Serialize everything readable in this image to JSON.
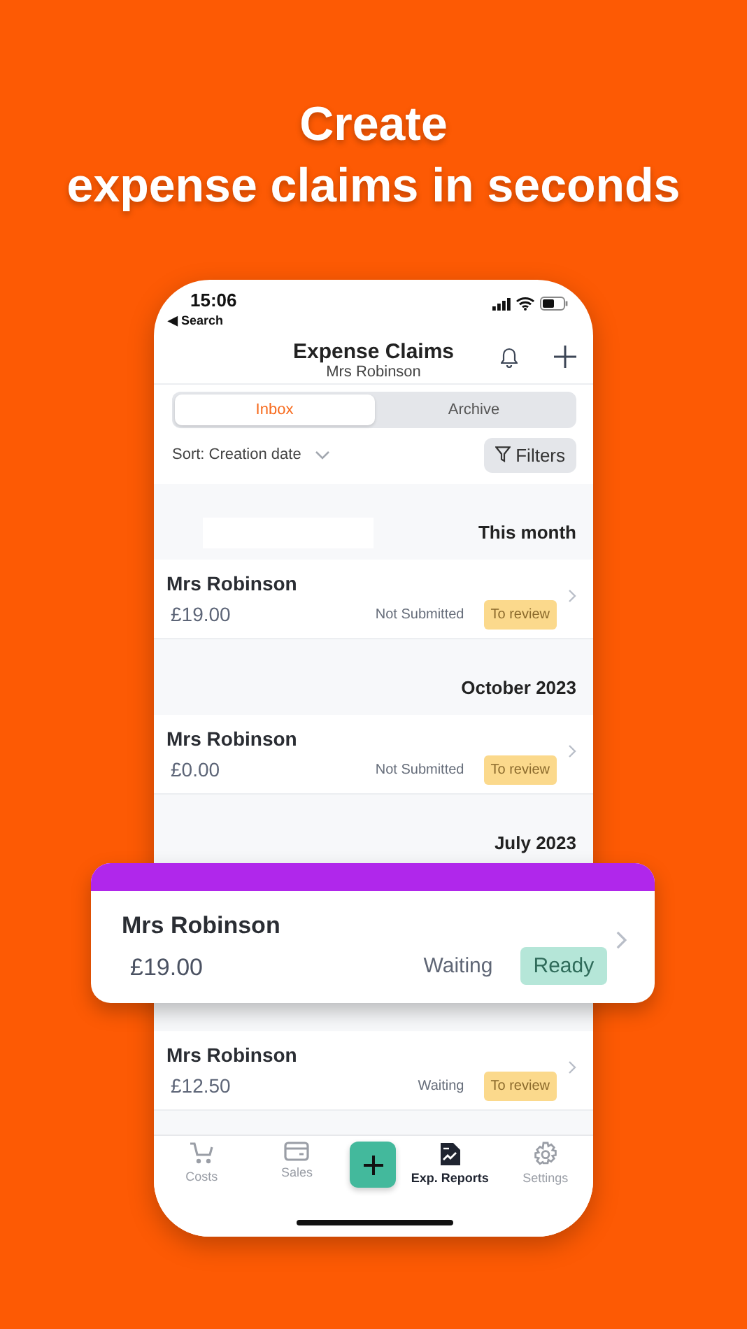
{
  "headline": [
    "Create",
    "expense claims in seconds"
  ],
  "status_bar": {
    "time": "15:06",
    "back_link": "◀ Search"
  },
  "header": {
    "title": "Expense Claims",
    "subtitle": "Mrs Robinson"
  },
  "tabs": [
    {
      "label": "Inbox",
      "selected": true
    },
    {
      "label": "Archive",
      "selected": false
    }
  ],
  "sort": "Sort: Creation date",
  "filters_button": "Filters",
  "list": [
    {
      "kind": "heading",
      "text": "This month"
    },
    {
      "kind": "claim",
      "name": "Mrs Robinson",
      "amount": "£19.00",
      "status": "Not Submitted",
      "badge": {
        "label": "To review",
        "kind": "review"
      }
    },
    {
      "kind": "heading",
      "text": "October 2023"
    },
    {
      "kind": "claim",
      "name": "Mrs Robinson",
      "amount": "£0.00",
      "status": "Not Submitted",
      "badge": {
        "label": "To review",
        "kind": "review"
      }
    },
    {
      "kind": "heading",
      "text": "July 2023"
    },
    {
      "kind": "heading"
    },
    {
      "kind": "claim",
      "name": "Mrs Robinson",
      "amount": "£12.50",
      "status": "Waiting",
      "badge": {
        "label": "To review",
        "kind": "review"
      }
    }
  ],
  "floating_card": {
    "name": "Mrs Robinson",
    "amount": "£19.00",
    "status": "Waiting",
    "badge": {
      "label": "Ready",
      "kind": "ready"
    }
  },
  "bottom_nav": [
    {
      "label": "Costs",
      "selected": false
    },
    {
      "label": "Sales",
      "selected": false
    },
    {
      "label": "Exp. Reports",
      "selected": true
    },
    {
      "label": "Settings",
      "selected": false
    }
  ]
}
